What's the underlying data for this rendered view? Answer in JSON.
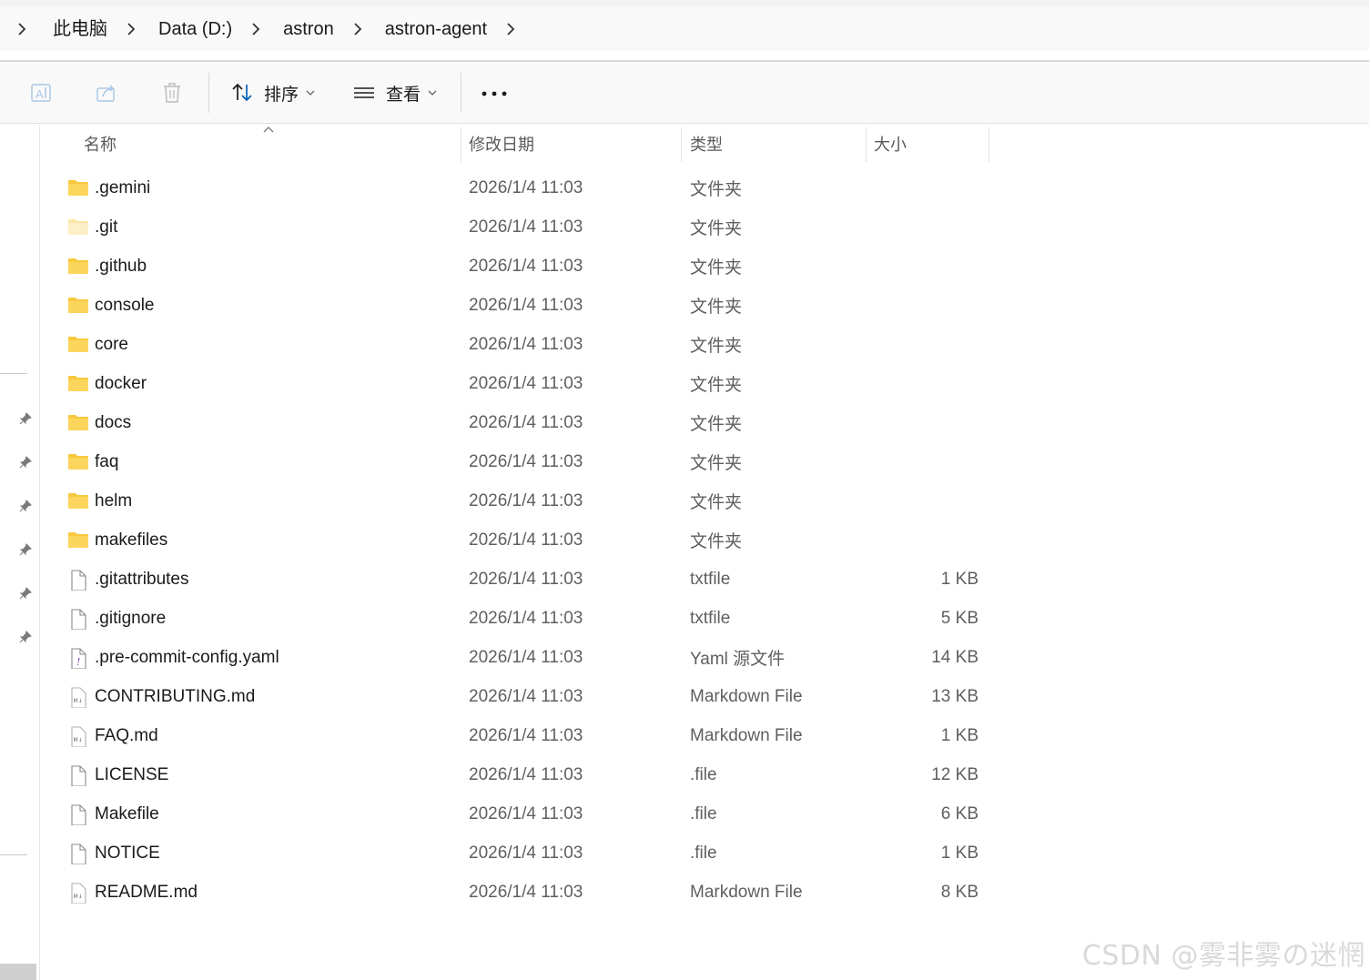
{
  "breadcrumb": {
    "items": [
      "此电脑",
      "Data (D:)",
      "astron",
      "astron-agent"
    ]
  },
  "toolbar": {
    "sort_label": "排序",
    "view_label": "查看",
    "more_label": "..."
  },
  "columns": {
    "name": "名称",
    "modified": "修改日期",
    "type": "类型",
    "size": "大小"
  },
  "files": [
    {
      "name": ".gemini",
      "modified": "2026/1/4 11:03",
      "type": "文件夹",
      "size": "",
      "icon": "folder-icon"
    },
    {
      "name": ".git",
      "modified": "2026/1/4 11:03",
      "type": "文件夹",
      "size": "",
      "icon": "folder-hidden-icon"
    },
    {
      "name": ".github",
      "modified": "2026/1/4 11:03",
      "type": "文件夹",
      "size": "",
      "icon": "folder-icon"
    },
    {
      "name": "console",
      "modified": "2026/1/4 11:03",
      "type": "文件夹",
      "size": "",
      "icon": "folder-icon"
    },
    {
      "name": "core",
      "modified": "2026/1/4 11:03",
      "type": "文件夹",
      "size": "",
      "icon": "folder-icon"
    },
    {
      "name": "docker",
      "modified": "2026/1/4 11:03",
      "type": "文件夹",
      "size": "",
      "icon": "folder-icon"
    },
    {
      "name": "docs",
      "modified": "2026/1/4 11:03",
      "type": "文件夹",
      "size": "",
      "icon": "folder-icon"
    },
    {
      "name": "faq",
      "modified": "2026/1/4 11:03",
      "type": "文件夹",
      "size": "",
      "icon": "folder-icon"
    },
    {
      "name": "helm",
      "modified": "2026/1/4 11:03",
      "type": "文件夹",
      "size": "",
      "icon": "folder-icon"
    },
    {
      "name": "makefiles",
      "modified": "2026/1/4 11:03",
      "type": "文件夹",
      "size": "",
      "icon": "folder-icon"
    },
    {
      "name": ".gitattributes",
      "modified": "2026/1/4 11:03",
      "type": "txtfile",
      "size": "1 KB",
      "icon": "file-icon"
    },
    {
      "name": ".gitignore",
      "modified": "2026/1/4 11:03",
      "type": "txtfile",
      "size": "5 KB",
      "icon": "file-icon"
    },
    {
      "name": ".pre-commit-config.yaml",
      "modified": "2026/1/4 11:03",
      "type": "Yaml 源文件",
      "size": "14 KB",
      "icon": "yaml-file-icon"
    },
    {
      "name": "CONTRIBUTING.md",
      "modified": "2026/1/4 11:03",
      "type": "Markdown File",
      "size": "13 KB",
      "icon": "markdown-file-icon"
    },
    {
      "name": "FAQ.md",
      "modified": "2026/1/4 11:03",
      "type": "Markdown File",
      "size": "1 KB",
      "icon": "markdown-file-icon"
    },
    {
      "name": "LICENSE",
      "modified": "2026/1/4 11:03",
      "type": ".file",
      "size": "12 KB",
      "icon": "file-icon"
    },
    {
      "name": "Makefile",
      "modified": "2026/1/4 11:03",
      "type": ".file",
      "size": "6 KB",
      "icon": "file-icon"
    },
    {
      "name": "NOTICE",
      "modified": "2026/1/4 11:03",
      "type": ".file",
      "size": "1 KB",
      "icon": "file-icon"
    },
    {
      "name": "README.md",
      "modified": "2026/1/4 11:03",
      "type": "Markdown File",
      "size": "8 KB",
      "icon": "markdown-file-icon"
    }
  ],
  "watermark": "CSDN @雾非雾の迷惘",
  "colors": {
    "folder": "#f8c93e",
    "folder_hidden": "#fbe6a6",
    "accent": "#005fb8"
  }
}
